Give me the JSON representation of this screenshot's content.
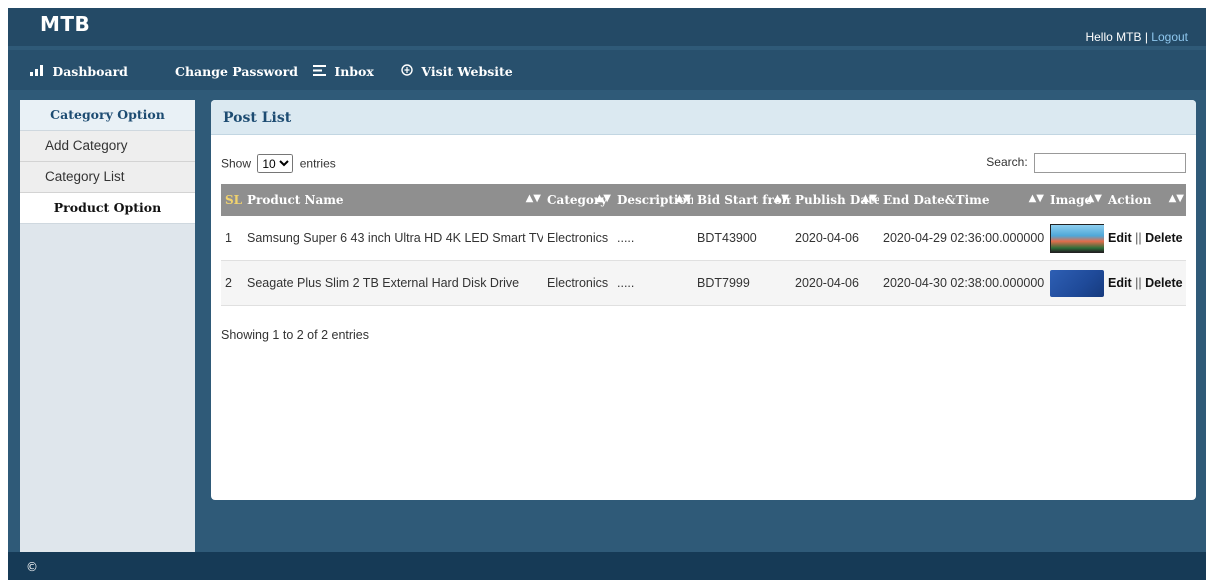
{
  "header": {
    "brand": "MTB",
    "greeting": "Hello MTB",
    "separator": "|",
    "logout": "Logout"
  },
  "nav": {
    "dashboard": {
      "icon": "bar-chart-icon",
      "label": "Dashboard"
    },
    "change_password": {
      "label": "Change Password"
    },
    "inbox": {
      "icon": "inbox-icon",
      "label": "Inbox"
    },
    "visit_website": {
      "icon": "globe-icon",
      "label": "Visit Website"
    }
  },
  "sidebar": {
    "category_heading": "Category Option",
    "items": [
      "Add Category",
      "Category List"
    ],
    "product_heading": "Product Option"
  },
  "panel": {
    "title": "Post List",
    "show_label": "Show",
    "entries_value": "10",
    "entries_label": "entries",
    "search_label": "Search:",
    "search_value": "",
    "columns": [
      "SL",
      "Product Name",
      "Category",
      "Description",
      "Bid Start from",
      "Publish Date",
      "End Date&Time",
      "Image",
      "Action"
    ],
    "rows": [
      {
        "sl": "1",
        "product": "Samsung Super 6 43 inch Ultra HD 4K LED Smart TV",
        "category": "Electronics",
        "description": ".....",
        "bid": "BDT43900",
        "publish": "2020-04-06",
        "end": "2020-04-29 02:36:00.000000",
        "image": "tv-thumbnail"
      },
      {
        "sl": "2",
        "product": "Seagate Plus Slim 2 TB External Hard Disk Drive",
        "category": "Electronics",
        "description": ".....",
        "bid": "BDT7999",
        "publish": "2020-04-06",
        "end": "2020-04-30 02:38:00.000000",
        "image": "hard-disk-thumbnail"
      }
    ],
    "action_edit": "Edit",
    "action_separator": "||",
    "action_delete": "Delete",
    "info": "Showing 1 to 2 of 2 entries"
  },
  "footer": {
    "copyright": "©"
  },
  "colors": {
    "frame": "#2f5a78",
    "topbar": "#244a66",
    "footer": "#163a56",
    "panel_head": "#dbe9f1",
    "table_head": "#8f8f8f",
    "link": "#8ec7ee"
  }
}
